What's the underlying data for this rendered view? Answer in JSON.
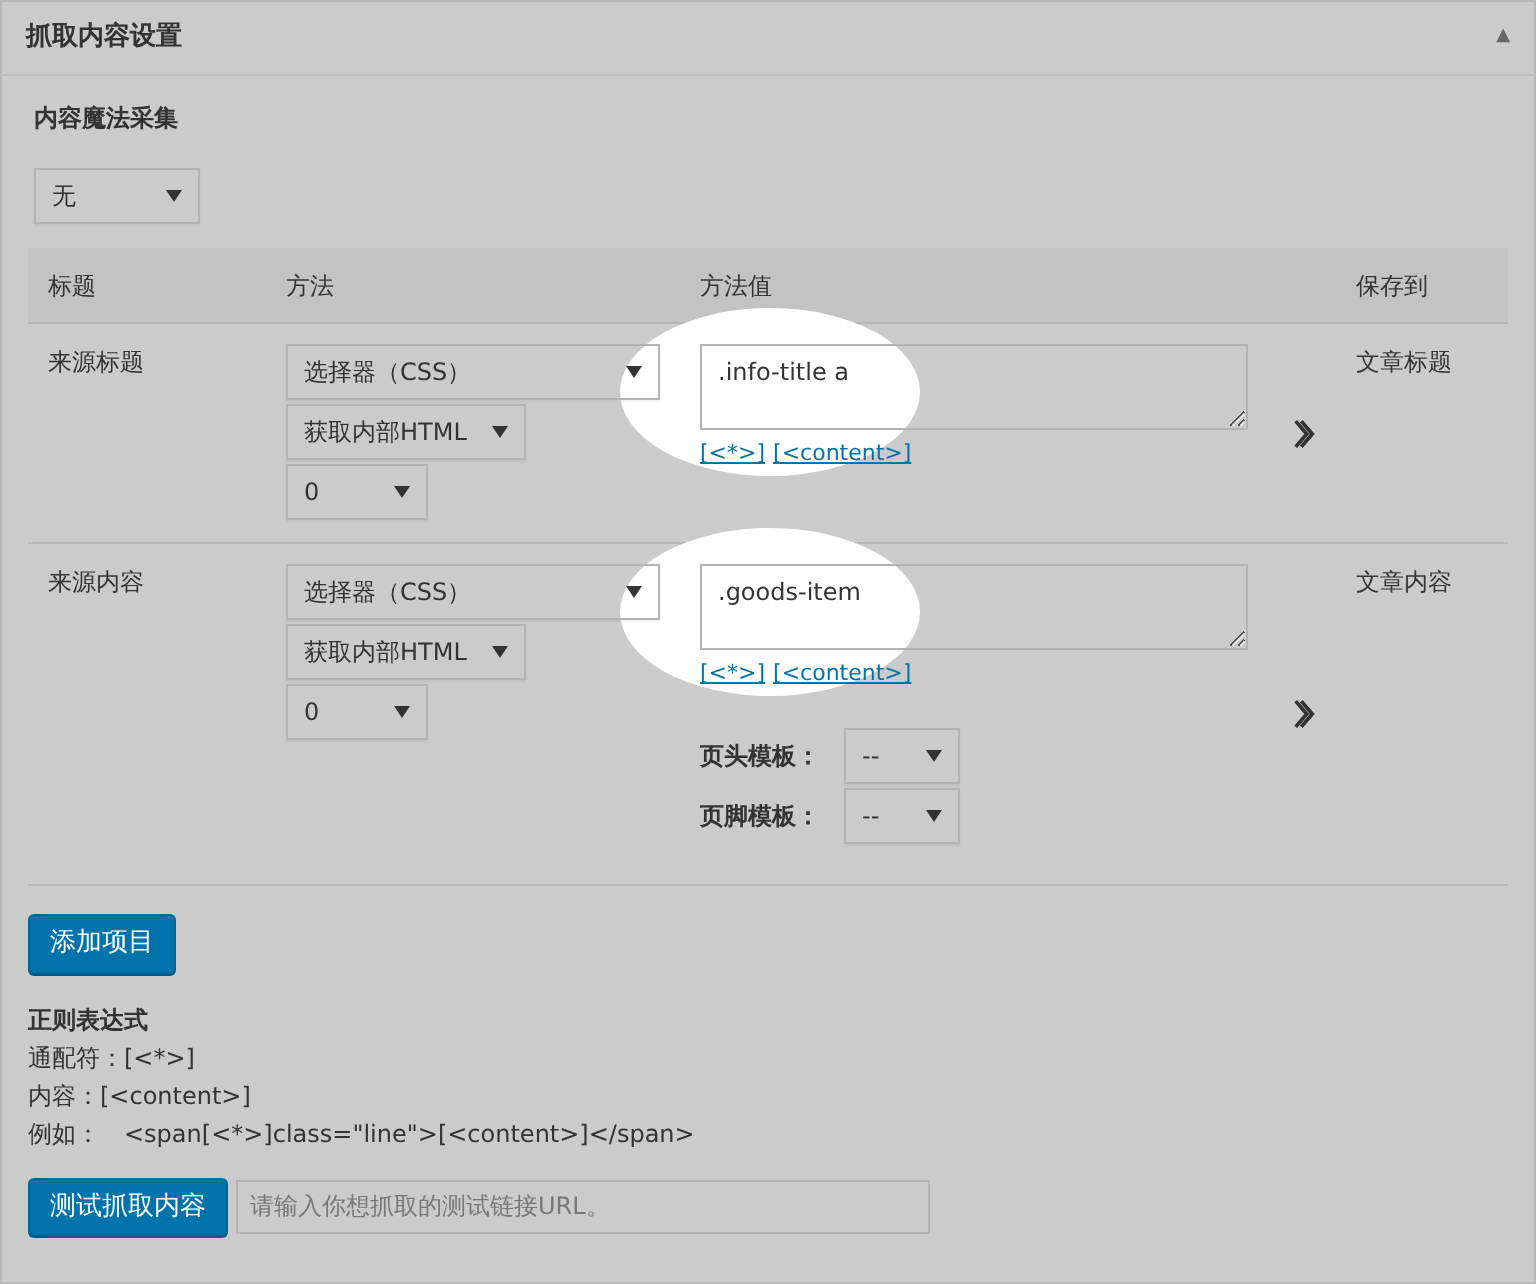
{
  "panel": {
    "title": "抓取内容设置",
    "toggle": "▲"
  },
  "magic": {
    "label": "内容魔法采集",
    "select": "无"
  },
  "table": {
    "columns": [
      "标题",
      "方法",
      "方法值",
      "保存到"
    ],
    "rows": [
      {
        "title": "来源标题",
        "method": "选择器（CSS）",
        "extract": "获取内部HTML",
        "index": "0",
        "value": ".info-title a",
        "tokens": [
          "[<*>]",
          "[<content>]"
        ],
        "highlighted": true,
        "save_to": "文章标题",
        "templates": []
      },
      {
        "title": "来源内容",
        "method": "选择器（CSS）",
        "extract": "获取内部HTML",
        "index": "0",
        "value": ".goods-item",
        "tokens": [
          "[<*>]",
          "[<content>]"
        ],
        "highlighted": true,
        "save_to": "文章内容",
        "templates": [
          {
            "label": "页头模板：",
            "value": "--"
          },
          {
            "label": "页脚模板：",
            "value": "--"
          }
        ]
      }
    ]
  },
  "add_button": "添加项目",
  "regex": {
    "title": "正则表达式",
    "lines": [
      {
        "label": "通配符：",
        "value": "[<*>]"
      },
      {
        "label": "内容：",
        "value": "[<content>]"
      },
      {
        "label": "例如：",
        "value": "<span[<*>]class=\"line\">[<content>]</span>"
      }
    ]
  },
  "test": {
    "button": "测试抓取内容",
    "placeholder": "请输入你想抓取的测试链接URL。"
  }
}
